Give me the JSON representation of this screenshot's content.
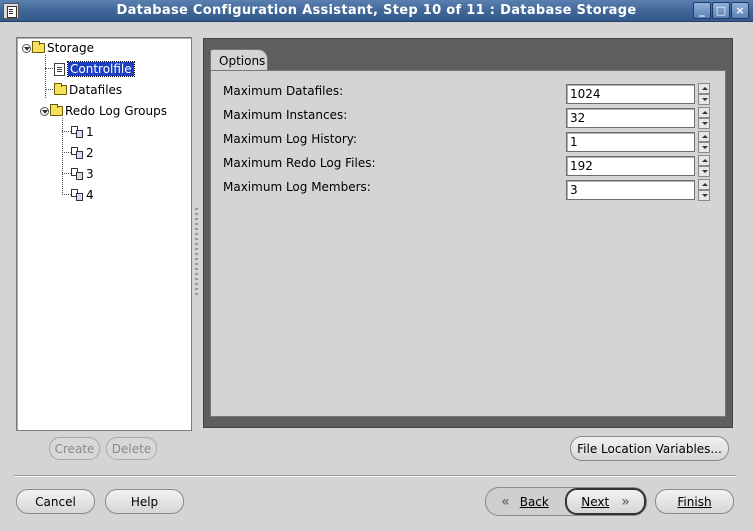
{
  "window": {
    "title": "Database Configuration Assistant, Step 10 of 11 : Database Storage",
    "controls": [
      "_",
      "□",
      "×"
    ]
  },
  "tree": {
    "root": "Storage",
    "items": {
      "controlfile": "Controlfile",
      "datafiles": "Datafiles",
      "redo_log_groups": "Redo Log Groups",
      "groups": [
        "1",
        "2",
        "3",
        "4"
      ]
    },
    "selected": "Controlfile"
  },
  "tabs": {
    "options": "Options"
  },
  "fields": [
    {
      "label": "Maximum Datafiles:",
      "value": "1024"
    },
    {
      "label": "Maximum Instances:",
      "value": "32"
    },
    {
      "label": "Maximum Log History:",
      "value": "1"
    },
    {
      "label": "Maximum Redo Log Files:",
      "value": "192"
    },
    {
      "label": "Maximum Log Members:",
      "value": "3"
    }
  ],
  "buttons": {
    "create": "Create",
    "delete": "Delete",
    "file_location_variables": "File Location Variables...",
    "cancel": "Cancel",
    "help": "Help",
    "back": "Back",
    "next": "Next",
    "finish": "Finish"
  },
  "icons": {
    "chevron_left": "«",
    "chevron_right": "»"
  },
  "colors": {
    "title_bar": "#3f6698",
    "selection": "#1c3fc2",
    "panel_dark": "#5e5e5e",
    "background": "#d4d4d4"
  }
}
